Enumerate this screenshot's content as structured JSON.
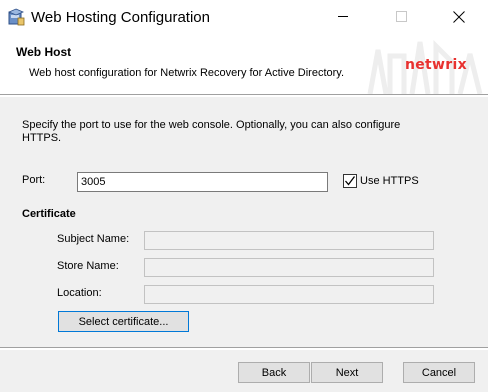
{
  "window": {
    "title": "Web Hosting Configuration",
    "icon": "installer-package-icon",
    "controls": [
      "minimize-icon",
      "maximize-icon",
      "close-icon"
    ]
  },
  "header": {
    "title": "Web Host",
    "description": "Web host configuration for Netwrix Recovery for Active Directory.",
    "logo": "netwrix",
    "logo_color": "#e8312f"
  },
  "main": {
    "intro": "Specify the port to use for the web console.  Optionally, you can also configure HTTPS.",
    "port": {
      "label": "Port:",
      "value": "3005"
    },
    "use_https": {
      "label": "Use HTTPS",
      "checked": true
    },
    "certificate": {
      "heading": "Certificate",
      "subject_name_label": "Subject Name:",
      "subject_name_value": "",
      "store_name_label": "Store Name:",
      "store_name_value": "",
      "location_label": "Location:",
      "location_value": "",
      "select_button": "Select certificate..."
    }
  },
  "footer": {
    "back": "Back",
    "next": "Next",
    "cancel": "Cancel"
  }
}
